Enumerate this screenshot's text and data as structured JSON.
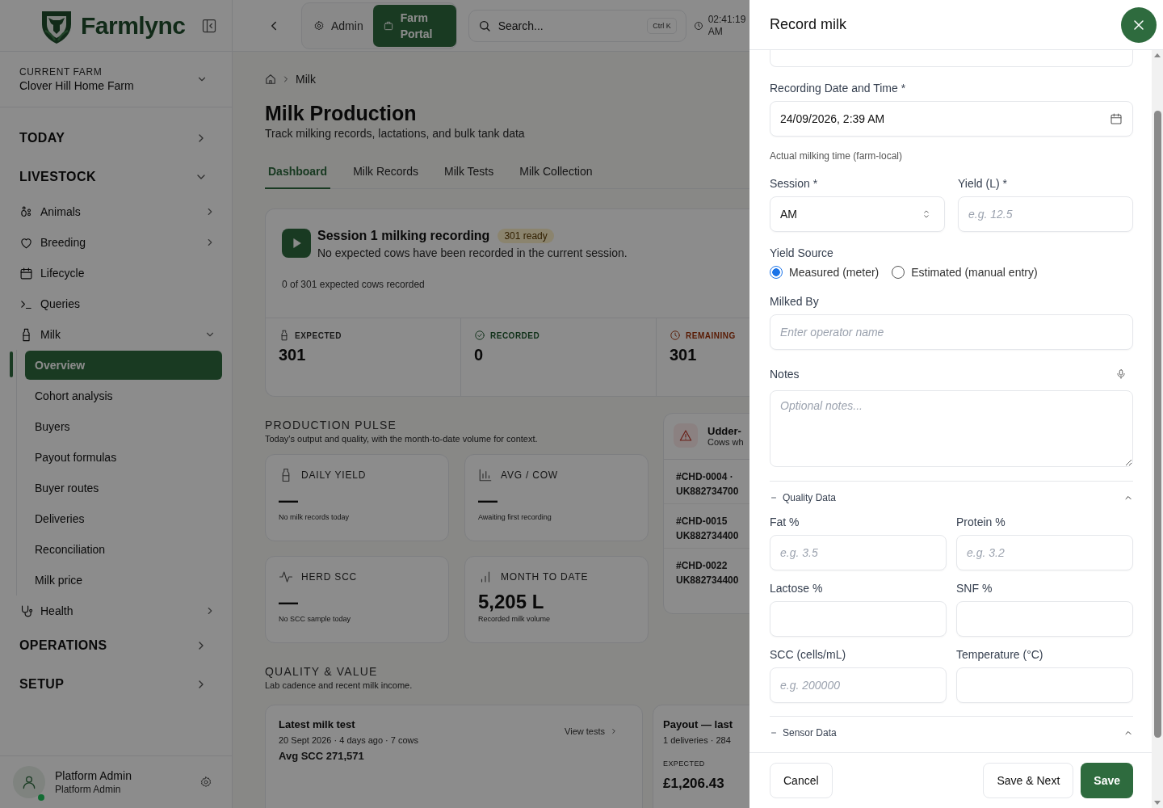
{
  "sidebar": {
    "brand": "Farmlync",
    "current_farm": {
      "label": "CURRENT FARM",
      "name": "Clover Hill Home Farm"
    },
    "sections": [
      {
        "label": "TODAY",
        "expanded": false
      },
      {
        "label": "LIVESTOCK",
        "expanded": true,
        "items": [
          {
            "label": "Animals",
            "kind": "group",
            "expanded": false
          },
          {
            "label": "Breeding",
            "kind": "group",
            "expanded": false
          },
          {
            "label": "Lifecycle",
            "kind": "link"
          },
          {
            "label": "Queries",
            "kind": "link"
          },
          {
            "label": "Milk",
            "kind": "group",
            "expanded": true,
            "children": [
              {
                "label": "Overview",
                "selected": true
              },
              {
                "label": "Cohort analysis",
                "selected": false
              },
              {
                "label": "Buyers",
                "selected": false
              },
              {
                "label": "Payout formulas",
                "selected": false
              },
              {
                "label": "Buyer routes",
                "selected": false
              },
              {
                "label": "Deliveries",
                "selected": false
              },
              {
                "label": "Reconciliation",
                "selected": false
              },
              {
                "label": "Milk price",
                "selected": false
              }
            ]
          },
          {
            "label": "Health",
            "kind": "group",
            "expanded": false
          }
        ]
      },
      {
        "label": "OPERATIONS",
        "expanded": false
      },
      {
        "label": "SETUP",
        "expanded": false
      }
    ],
    "user": {
      "name": "Platform Admin",
      "role": "Platform Admin",
      "online": true
    }
  },
  "topbar": {
    "modes": [
      {
        "label": "Admin",
        "selected": false
      },
      {
        "label": "Farm Portal",
        "selected": true
      }
    ],
    "search": {
      "placeholder": "Search...",
      "shortcut": "Ctrl K"
    },
    "clock": "02:41:19 AM"
  },
  "page": {
    "breadcrumb": [
      "Milk"
    ],
    "title": "Milk Production",
    "subtitle": "Track milking records, lactations, and bulk tank data",
    "tabs": [
      {
        "label": "Dashboard",
        "selected": true
      },
      {
        "label": "Milk Records",
        "selected": false
      },
      {
        "label": "Milk Tests",
        "selected": false
      },
      {
        "label": "Milk Collection",
        "selected": false
      }
    ],
    "session": {
      "title": "Session 1 milking recording",
      "badge": "301 ready",
      "description": "No expected cows have been recorded in the current session.",
      "progress": "0 of 301 expected cows recorded",
      "stats": [
        {
          "label": "EXPECTED",
          "value": "301",
          "kind": "neutral"
        },
        {
          "label": "RECORDED",
          "value": "0",
          "kind": "success"
        },
        {
          "label": "REMAINING",
          "value": "301",
          "kind": "warning"
        }
      ]
    },
    "pulse": {
      "heading": "PRODUCTION PULSE",
      "description": "Today's output and quality, with the month-to-date volume for context.",
      "cards": [
        {
          "label": "DAILY YIELD",
          "value": "—",
          "note": "No milk records today"
        },
        {
          "label": "AVG / COW",
          "value": "—",
          "note": "Awaiting first recording"
        },
        {
          "label": "HERD SCC",
          "value": "—",
          "note": "No SCC sample today"
        },
        {
          "label": "MONTH TO DATE",
          "value": "5,205 L",
          "note": "Recorded milk volume"
        }
      ],
      "alert": {
        "title": "Udder-",
        "subtitle": "Cows wh",
        "rows": [
          {
            "tag": "#CHD-0004 ·",
            "id": "UK882734700"
          },
          {
            "tag": "#CHD-0015",
            "id": "UK882734400"
          },
          {
            "tag": "#CHD-0022",
            "id": "UK882734400"
          }
        ]
      }
    },
    "quality": {
      "heading": "QUALITY & VALUE",
      "description": "Lab cadence and recent milk income.",
      "test": {
        "title": "Latest milk test",
        "meta": "20 Sept 2026 · 4 days ago · 7 cows",
        "value": "Avg SCC 271,571",
        "link": "View tests"
      },
      "payout": {
        "title": "Payout — last",
        "meta": "1 deliveries · 284",
        "label": "EXPECTED",
        "value": "£1,206.43"
      }
    }
  },
  "drawer": {
    "title": "Record milk",
    "date": {
      "label": "Recording Date and Time *",
      "value": "24/09/2026, 2:39 AM",
      "hint": "Actual milking time (farm-local)"
    },
    "session": {
      "label": "Session *",
      "value": "AM"
    },
    "yield": {
      "label": "Yield (L) *",
      "placeholder": "e.g. 12.5"
    },
    "yield_source": {
      "label": "Yield Source",
      "options": [
        {
          "label": "Measured (meter)",
          "selected": true
        },
        {
          "label": "Estimated (manual entry)",
          "selected": false
        }
      ]
    },
    "milked_by": {
      "label": "Milked By",
      "placeholder": "Enter operator name"
    },
    "notes": {
      "label": "Notes",
      "placeholder": "Optional notes..."
    },
    "sections": [
      {
        "title": "Quality Data",
        "expanded": true,
        "fields": [
          {
            "label": "Fat %",
            "placeholder": "e.g. 3.5"
          },
          {
            "label": "Protein %",
            "placeholder": "e.g. 3.2"
          },
          {
            "label": "Lactose %"
          },
          {
            "label": "SNF %"
          },
          {
            "label": "SCC (cells/mL)",
            "placeholder": "e.g. 200000"
          },
          {
            "label": "Temperature (°C)"
          }
        ]
      },
      {
        "title": "Sensor Data",
        "expanded": true
      }
    ],
    "buttons": [
      {
        "label": "Cancel",
        "kind": "secondary"
      },
      {
        "label": "Save & Next",
        "kind": "secondary"
      },
      {
        "label": "Save",
        "kind": "primary"
      }
    ]
  }
}
